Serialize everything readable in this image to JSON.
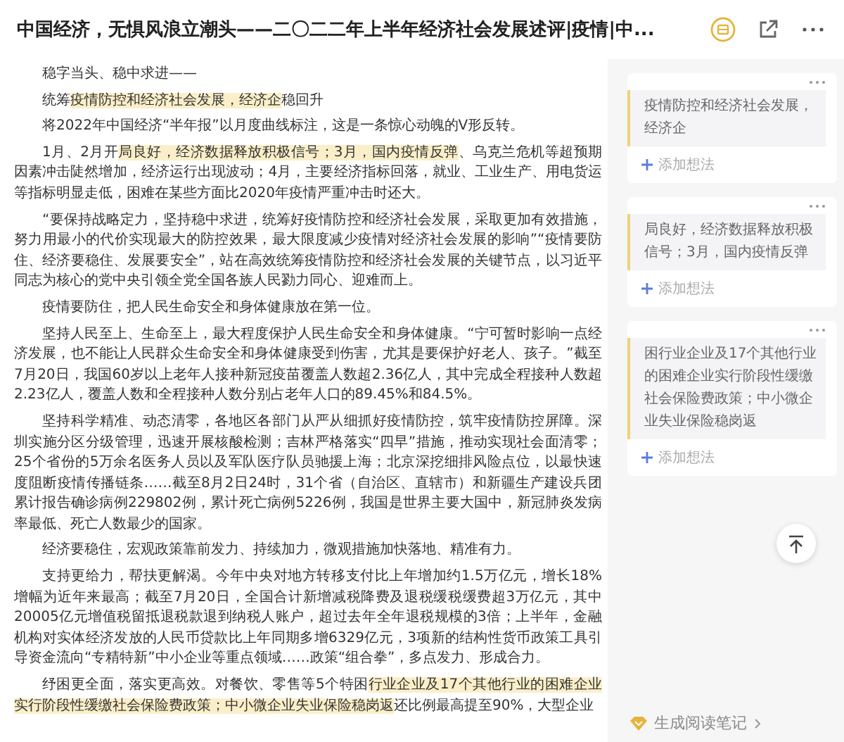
{
  "header": {
    "title": "中国经济，无惧风浪立潮头——二〇二二年上半年经济社会发展述评|疫情|中..."
  },
  "article": {
    "paragraphs": [
      {
        "segments": [
          {
            "text": "稳字当头、稳中求进——",
            "highlight": false
          }
        ]
      },
      {
        "segments": [
          {
            "text": "统筹",
            "highlight": false
          },
          {
            "text": "疫情防控和经济社会发展，经济企",
            "highlight": true
          },
          {
            "text": "稳回升",
            "highlight": false
          }
        ]
      },
      {
        "segments": [
          {
            "text": "将2022年中国经济“半年报”以月度曲线标注，这是一条惊心动魄的V形反转。",
            "highlight": false
          }
        ]
      },
      {
        "segments": [
          {
            "text": "1月、2月开",
            "highlight": false
          },
          {
            "text": "局良好，经济数据释放积极信号；3月，国内疫情反弹",
            "highlight": true
          },
          {
            "text": "、乌克兰危机等超预期因素冲击陡然增加，经济运行出现波动；4月，主要经济指标回落，就业、工业生产、用电货运等指标明显走低，困难在某些方面比2020年疫情严重冲击时还大。",
            "highlight": false
          }
        ]
      },
      {
        "segments": [
          {
            "text": "“要保持战略定力，坚持稳中求进，统筹好疫情防控和经济社会发展，采取更加有效措施，努力用最小的代价实现最大的防控效果，最大限度减少疫情对经济社会发展的影响”“疫情要防住、经济要稳住、发展要安全”，站在高效统筹疫情防控和经济社会发展的关键节点，以习近平同志为核心的党中央引领全党全国各族人民勠力同心、迎难而上。",
            "highlight": false
          }
        ]
      },
      {
        "segments": [
          {
            "text": "疫情要防住，把人民生命安全和身体健康放在第一位。",
            "highlight": false
          }
        ]
      },
      {
        "segments": [
          {
            "text": "坚持人民至上、生命至上，最大程度保护人民生命安全和身体健康。“宁可暂时影响一点经济发展，也不能让人民群众生命安全和身体健康受到伤害，尤其是要保护好老人、孩子。”截至7月20日，我国60岁以上老年人接种新冠疫苗覆盖人数超2.36亿人，其中完成全程接种人数超2.23亿人，覆盖人数和全程接种人数分别占老年人口的89.45%和84.5%。",
            "highlight": false
          }
        ]
      },
      {
        "segments": [
          {
            "text": "坚持科学精准、动态清零，各地区各部门从严从细抓好疫情防控，筑牢疫情防控屏障。深圳实施分区分级管理，迅速开展核酸检测；吉林严格落实“四早”措施，推动实现社会面清零；25个省份的5万余名医务人员以及军队医疗队员驰援上海；北京深挖细排风险点位，以最快速度阻断疫情传播链条……截至8月2日24时，31个省（自治区、直辖市）和新疆生产建设兵团累计报告确诊病例229802例，累计死亡病例5226例，我国是世界主要大国中，新冠肺炎发病率最低、死亡人数最少的国家。",
            "highlight": false
          }
        ]
      },
      {
        "segments": [
          {
            "text": "经济要稳住，宏观政策靠前发力、持续加力，微观措施加快落地、精准有力。",
            "highlight": false
          }
        ]
      },
      {
        "segments": [
          {
            "text": "支持更给力，帮扶更解渴。今年中央对地方转移支付比上年增加约1.5万亿元，增长18%增幅为近年来最高；截至7月20日，全国合计新增减税降费及退税缓税缓费超3万亿元，其中20005亿元增值税留抵退税款退到纳税人账户，超过去年全年退税规模的3倍；上半年，金融机构对实体经济发放的人民币贷款比上年同期多增6329亿元，3项新的结构性货币政策工具引导资金流向“专精特新”中小企业等重点领域……政策“组合拳”，多点发力、形成合力。",
            "highlight": false
          }
        ]
      },
      {
        "segments": [
          {
            "text": "纾困更全面，落实更高效。对餐饮、零售等5个特困",
            "highlight": false
          },
          {
            "text": "行业企业及17个其他行业的困难企业实行阶段性缓缴社会保险费政策；中小微企业失业保险稳岗返",
            "highlight": true
          },
          {
            "text": "还比例最高提至90%，大型企业",
            "highlight": false
          }
        ]
      }
    ]
  },
  "notes": [
    {
      "quote": "疫情防控和经济社会发展，经济企",
      "action": "添加想法"
    },
    {
      "quote": "局良好，经济数据释放积极信号；3月，国内疫情反弹",
      "action": "添加想法"
    },
    {
      "quote": "困行业企业及17个其他行业的困难企业实行阶段性缓缴社会保险费政策；中小微企业失业保险稳岗返",
      "action": "添加想法"
    }
  ],
  "footer": {
    "label": "生成阅读笔记"
  }
}
